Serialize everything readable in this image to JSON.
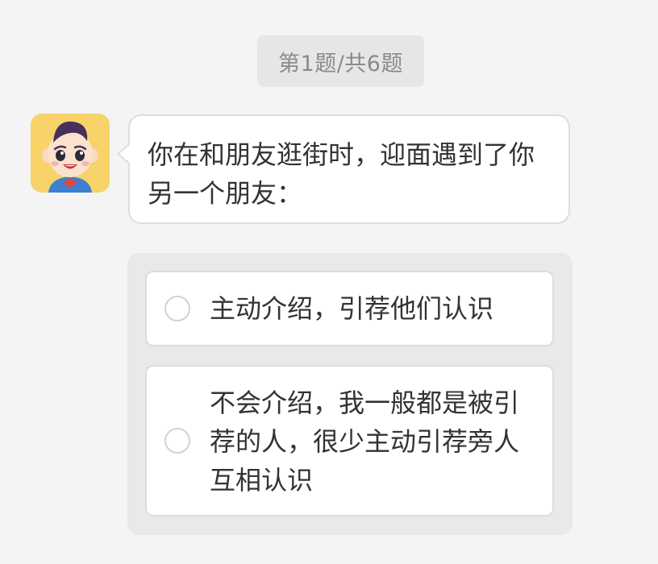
{
  "header": {
    "progress": "第1题/共6题"
  },
  "question": {
    "text": "你在和朋友逛街时，迎面遇到了你另一个朋友："
  },
  "options": [
    {
      "label": "主动介绍，引荐他们认识",
      "selected": false
    },
    {
      "label": "不会介绍，我一般都是被引荐的人，很少主动引荐旁人互相认识",
      "selected": false
    }
  ],
  "colors": {
    "background": "#f4f4f4",
    "avatar_bg": "#f7d36a",
    "pill_bg": "#e6e6e6",
    "panel_bg": "#e9e9e9"
  },
  "icons": {
    "avatar": "cartoon-boy-avatar-icon",
    "radio": "radio-unchecked-icon"
  }
}
